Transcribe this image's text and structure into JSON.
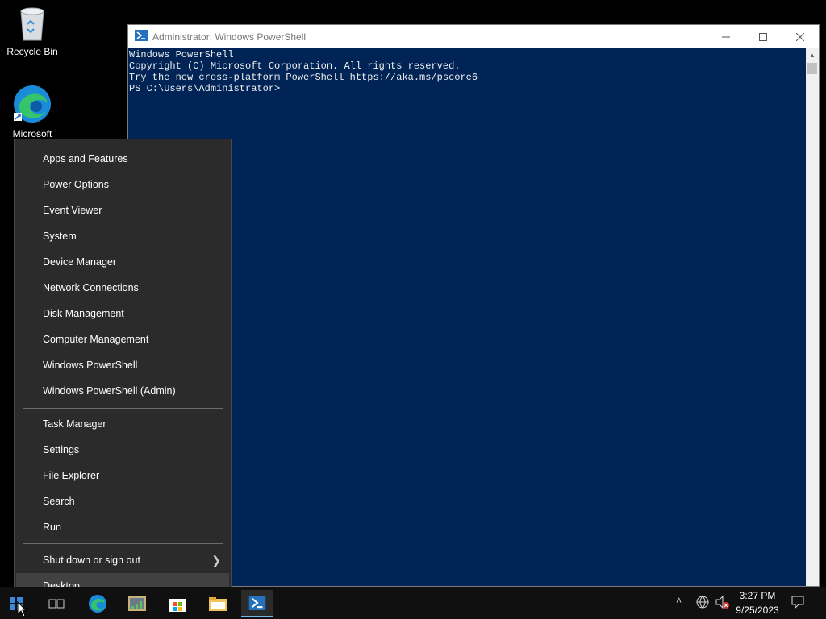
{
  "desktop": {
    "icons": [
      {
        "label": "Recycle Bin"
      },
      {
        "label": "Microsoft"
      }
    ]
  },
  "powershell": {
    "title": "Administrator: Windows PowerShell",
    "console_lines": [
      "Windows PowerShell",
      "Copyright (C) Microsoft Corporation. All rights reserved.",
      "",
      "Try the new cross-platform PowerShell https://aka.ms/pscore6",
      "",
      "PS C:\\Users\\Administrator>"
    ],
    "background_color": "#012456"
  },
  "winx_menu": {
    "group1": [
      "Apps and Features",
      "Power Options",
      "Event Viewer",
      "System",
      "Device Manager",
      "Network Connections",
      "Disk Management",
      "Computer Management",
      "Windows PowerShell",
      "Windows PowerShell (Admin)"
    ],
    "group2": [
      "Task Manager",
      "Settings",
      "File Explorer",
      "Search",
      "Run"
    ],
    "shutdown": "Shut down or sign out",
    "desktop": "Desktop",
    "hovered_item": "Desktop"
  },
  "taskbar": {
    "apps": [
      "start-icon",
      "task-view-icon",
      "edge-icon",
      "server-manager-icon",
      "store-icon",
      "file-explorer-icon",
      "powershell-icon"
    ],
    "active_app": "powershell-icon",
    "clock_time": "3:27 PM",
    "clock_date": "9/25/2023"
  }
}
